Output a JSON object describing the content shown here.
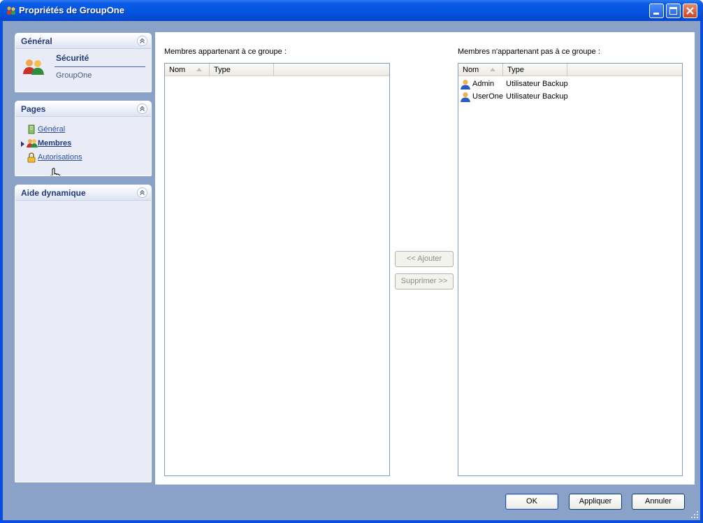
{
  "window": {
    "title": "Propriétés de GroupOne"
  },
  "sidebar": {
    "general": {
      "header": "Général",
      "section_title": "Sécurité",
      "section_subtitle": "GroupOne"
    },
    "pages": {
      "header": "Pages",
      "items": [
        {
          "label": "Général",
          "icon": "document-icon"
        },
        {
          "label": "Membres",
          "icon": "group-icon",
          "active": true
        },
        {
          "label": "Autorisations",
          "icon": "lock-icon"
        }
      ]
    },
    "help": {
      "header": "Aide dynamique"
    }
  },
  "main": {
    "members_in_label": "Membres appartenant à ce groupe :",
    "members_out_label": "Membres n'appartenant pas à ce groupe :",
    "columns": {
      "name": "Nom",
      "type": "Type"
    },
    "members_in": [],
    "members_out": [
      {
        "name": "Admin",
        "type": "Utilisateur Backup"
      },
      {
        "name": "UserOne",
        "type": "Utilisateur Backup"
      }
    ],
    "add_label": "<< Ajouter",
    "remove_label": "Supprimer >>"
  },
  "footer": {
    "ok_label": "OK",
    "apply_label": "Appliquer",
    "cancel_label": "Annuler"
  },
  "colors": {
    "titlebar": "#0454de",
    "client_background": "#8aa2c8",
    "panel_background": "#e9ecf6",
    "link": "#2a4fa0"
  }
}
